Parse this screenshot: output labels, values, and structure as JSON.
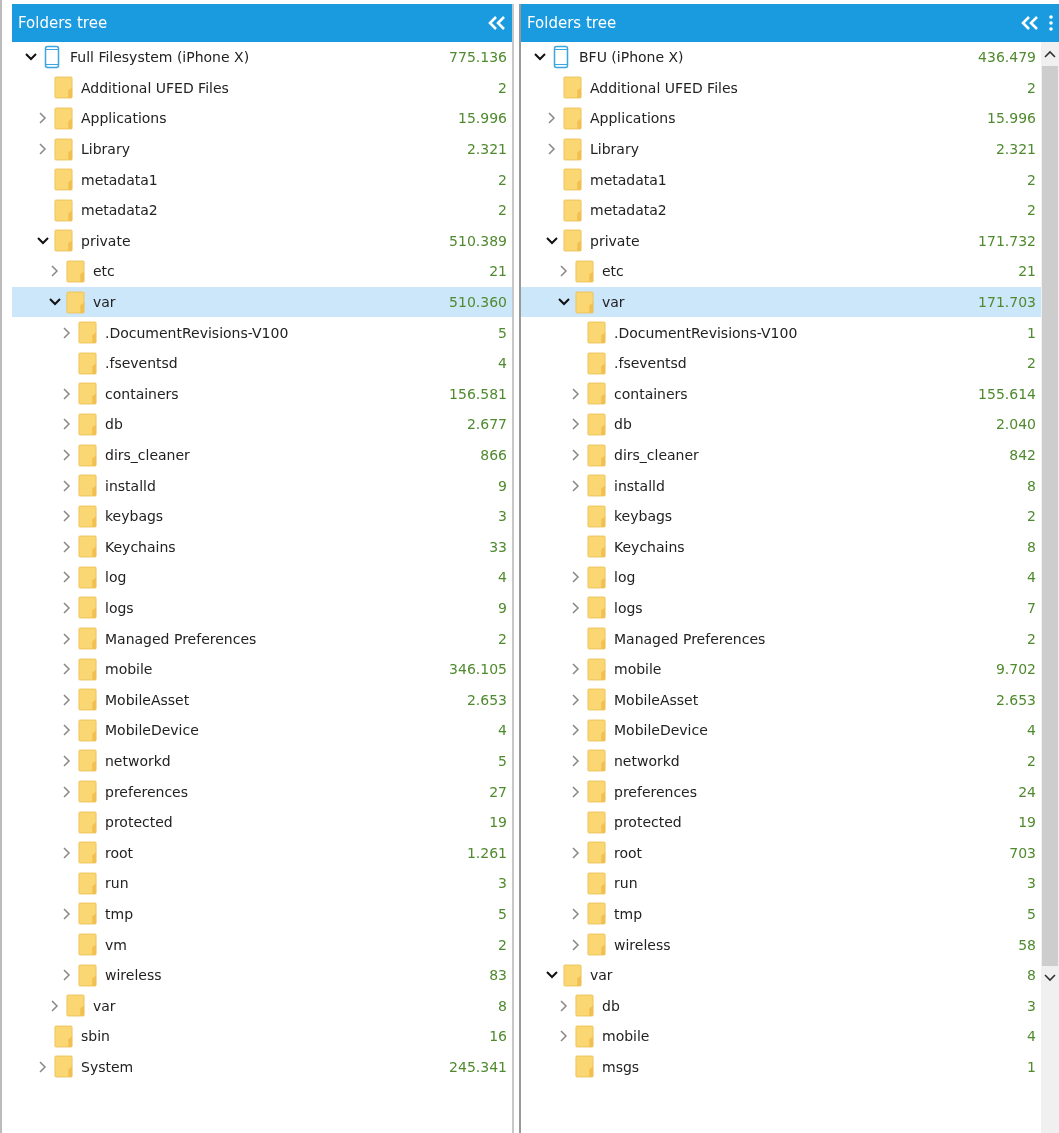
{
  "panels": [
    {
      "title": "Folders tree",
      "menu": false,
      "scrollbar": false,
      "tree": [
        {
          "kind": "device",
          "name": "Full Filesystem (iPhone X)",
          "count": "775.136",
          "expanded": true,
          "selected": false,
          "children": [
            {
              "kind": "folder",
              "name": "Additional UFED Files",
              "count": "2",
              "selected": false
            },
            {
              "kind": "folder",
              "name": "Applications",
              "count": "15.996",
              "expanded": false,
              "selected": false
            },
            {
              "kind": "folder",
              "name": "Library",
              "count": "2.321",
              "expanded": false,
              "selected": false
            },
            {
              "kind": "folder",
              "name": "metadata1",
              "count": "2",
              "selected": false
            },
            {
              "kind": "folder",
              "name": "metadata2",
              "count": "2",
              "selected": false
            },
            {
              "kind": "folder",
              "name": "private",
              "count": "510.389",
              "expanded": true,
              "selected": false,
              "children": [
                {
                  "kind": "folder",
                  "name": "etc",
                  "count": "21",
                  "expanded": false,
                  "selected": false
                },
                {
                  "kind": "folder",
                  "name": "var",
                  "count": "510.360",
                  "expanded": true,
                  "selected": true,
                  "children": [
                    {
                      "kind": "folder",
                      "name": ".DocumentRevisions-V100",
                      "count": "5",
                      "expanded": false,
                      "selected": false
                    },
                    {
                      "kind": "folder",
                      "name": ".fseventsd",
                      "count": "4",
                      "selected": false
                    },
                    {
                      "kind": "folder",
                      "name": "containers",
                      "count": "156.581",
                      "expanded": false,
                      "selected": false
                    },
                    {
                      "kind": "folder",
                      "name": "db",
                      "count": "2.677",
                      "expanded": false,
                      "selected": false
                    },
                    {
                      "kind": "folder",
                      "name": "dirs_cleaner",
                      "count": "866",
                      "expanded": false,
                      "selected": false
                    },
                    {
                      "kind": "folder",
                      "name": "installd",
                      "count": "9",
                      "expanded": false,
                      "selected": false
                    },
                    {
                      "kind": "folder",
                      "name": "keybags",
                      "count": "3",
                      "expanded": false,
                      "selected": false
                    },
                    {
                      "kind": "folder",
                      "name": "Keychains",
                      "count": "33",
                      "expanded": false,
                      "selected": false
                    },
                    {
                      "kind": "folder",
                      "name": "log",
                      "count": "4",
                      "expanded": false,
                      "selected": false
                    },
                    {
                      "kind": "folder",
                      "name": "logs",
                      "count": "9",
                      "expanded": false,
                      "selected": false
                    },
                    {
                      "kind": "folder",
                      "name": "Managed Preferences",
                      "count": "2",
                      "expanded": false,
                      "selected": false
                    },
                    {
                      "kind": "folder",
                      "name": "mobile",
                      "count": "346.105",
                      "expanded": false,
                      "selected": false
                    },
                    {
                      "kind": "folder",
                      "name": "MobileAsset",
                      "count": "2.653",
                      "expanded": false,
                      "selected": false
                    },
                    {
                      "kind": "folder",
                      "name": "MobileDevice",
                      "count": "4",
                      "expanded": false,
                      "selected": false
                    },
                    {
                      "kind": "folder",
                      "name": "networkd",
                      "count": "5",
                      "expanded": false,
                      "selected": false
                    },
                    {
                      "kind": "folder",
                      "name": "preferences",
                      "count": "27",
                      "expanded": false,
                      "selected": false
                    },
                    {
                      "kind": "folder",
                      "name": "protected",
                      "count": "19",
                      "selected": false
                    },
                    {
                      "kind": "folder",
                      "name": "root",
                      "count": "1.261",
                      "expanded": false,
                      "selected": false
                    },
                    {
                      "kind": "folder",
                      "name": "run",
                      "count": "3",
                      "selected": false
                    },
                    {
                      "kind": "folder",
                      "name": "tmp",
                      "count": "5",
                      "expanded": false,
                      "selected": false
                    },
                    {
                      "kind": "folder",
                      "name": "vm",
                      "count": "2",
                      "selected": false
                    },
                    {
                      "kind": "folder",
                      "name": "wireless",
                      "count": "83",
                      "expanded": false,
                      "selected": false
                    }
                  ]
                },
                {
                  "kind": "folder",
                  "name": "var",
                  "count": "8",
                  "expanded": false,
                  "selected": false
                }
              ]
            },
            {
              "kind": "folder",
              "name": "sbin",
              "count": "16",
              "selected": false
            },
            {
              "kind": "folder",
              "name": "System",
              "count": "245.341",
              "expanded": false,
              "selected": false
            }
          ]
        }
      ]
    },
    {
      "title": "Folders tree",
      "menu": true,
      "scrollbar": true,
      "tree": [
        {
          "kind": "device",
          "name": "BFU (iPhone X)",
          "count": "436.479",
          "expanded": true,
          "selected": false,
          "children": [
            {
              "kind": "folder",
              "name": "Additional UFED Files",
              "count": "2",
              "selected": false
            },
            {
              "kind": "folder",
              "name": "Applications",
              "count": "15.996",
              "expanded": false,
              "selected": false
            },
            {
              "kind": "folder",
              "name": "Library",
              "count": "2.321",
              "expanded": false,
              "selected": false
            },
            {
              "kind": "folder",
              "name": "metadata1",
              "count": "2",
              "selected": false
            },
            {
              "kind": "folder",
              "name": "metadata2",
              "count": "2",
              "selected": false
            },
            {
              "kind": "folder",
              "name": "private",
              "count": "171.732",
              "expanded": true,
              "selected": false,
              "children": [
                {
                  "kind": "folder",
                  "name": "etc",
                  "count": "21",
                  "expanded": false,
                  "selected": false
                },
                {
                  "kind": "folder",
                  "name": "var",
                  "count": "171.703",
                  "expanded": true,
                  "selected": true,
                  "children": [
                    {
                      "kind": "folder",
                      "name": ".DocumentRevisions-V100",
                      "count": "1",
                      "selected": false
                    },
                    {
                      "kind": "folder",
                      "name": ".fseventsd",
                      "count": "2",
                      "selected": false
                    },
                    {
                      "kind": "folder",
                      "name": "containers",
                      "count": "155.614",
                      "expanded": false,
                      "selected": false
                    },
                    {
                      "kind": "folder",
                      "name": "db",
                      "count": "2.040",
                      "expanded": false,
                      "selected": false
                    },
                    {
                      "kind": "folder",
                      "name": "dirs_cleaner",
                      "count": "842",
                      "expanded": false,
                      "selected": false
                    },
                    {
                      "kind": "folder",
                      "name": "installd",
                      "count": "8",
                      "expanded": false,
                      "selected": false
                    },
                    {
                      "kind": "folder",
                      "name": "keybags",
                      "count": "2",
                      "selected": false
                    },
                    {
                      "kind": "folder",
                      "name": "Keychains",
                      "count": "8",
                      "selected": false
                    },
                    {
                      "kind": "folder",
                      "name": "log",
                      "count": "4",
                      "expanded": false,
                      "selected": false
                    },
                    {
                      "kind": "folder",
                      "name": "logs",
                      "count": "7",
                      "expanded": false,
                      "selected": false
                    },
                    {
                      "kind": "folder",
                      "name": "Managed Preferences",
                      "count": "2",
                      "selected": false
                    },
                    {
                      "kind": "folder",
                      "name": "mobile",
                      "count": "9.702",
                      "expanded": false,
                      "selected": false
                    },
                    {
                      "kind": "folder",
                      "name": "MobileAsset",
                      "count": "2.653",
                      "expanded": false,
                      "selected": false
                    },
                    {
                      "kind": "folder",
                      "name": "MobileDevice",
                      "count": "4",
                      "expanded": false,
                      "selected": false
                    },
                    {
                      "kind": "folder",
                      "name": "networkd",
                      "count": "2",
                      "expanded": false,
                      "selected": false
                    },
                    {
                      "kind": "folder",
                      "name": "preferences",
                      "count": "24",
                      "expanded": false,
                      "selected": false
                    },
                    {
                      "kind": "folder",
                      "name": "protected",
                      "count": "19",
                      "selected": false
                    },
                    {
                      "kind": "folder",
                      "name": "root",
                      "count": "703",
                      "expanded": false,
                      "selected": false
                    },
                    {
                      "kind": "folder",
                      "name": "run",
                      "count": "3",
                      "selected": false
                    },
                    {
                      "kind": "folder",
                      "name": "tmp",
                      "count": "5",
                      "expanded": false,
                      "selected": false
                    },
                    {
                      "kind": "folder",
                      "name": "wireless",
                      "count": "58",
                      "expanded": false,
                      "selected": false
                    }
                  ]
                }
              ]
            },
            {
              "kind": "folder",
              "name": "var",
              "count": "8",
              "expanded": true,
              "selected": false,
              "children": [
                {
                  "kind": "folder",
                  "name": "db",
                  "count": "3",
                  "expanded": false,
                  "selected": false
                },
                {
                  "kind": "folder",
                  "name": "mobile",
                  "count": "4",
                  "expanded": false,
                  "selected": false
                },
                {
                  "kind": "folder",
                  "name": "msgs",
                  "count": "1",
                  "selected": false
                }
              ]
            }
          ]
        }
      ]
    }
  ]
}
